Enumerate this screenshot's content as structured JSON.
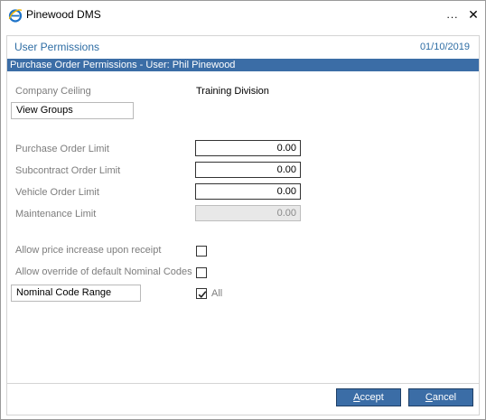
{
  "window": {
    "title": "Pinewood DMS",
    "more_glyph": "...",
    "close_glyph": "✕",
    "icon": "ie-browser-icon"
  },
  "dialog": {
    "section_title": "User Permissions",
    "date": "01/10/2019",
    "subheader": "Purchase Order Permissions - User: Phil Pinewood"
  },
  "company": {
    "label": "Company Ceiling",
    "value": "Training Division",
    "view_groups_label": "View Groups"
  },
  "limits": [
    {
      "label": "Purchase Order Limit",
      "value": "0.00",
      "enabled": true
    },
    {
      "label": "Subcontract Order Limit",
      "value": "0.00",
      "enabled": true
    },
    {
      "label": "Vehicle Order Limit",
      "value": "0.00",
      "enabled": true
    },
    {
      "label": "Maintenance Limit",
      "value": "0.00",
      "enabled": false
    }
  ],
  "options": {
    "price_increase_label": "Allow price increase upon receipt",
    "price_increase_checked": false,
    "override_nominal_label": "Allow override of default Nominal Codes",
    "override_nominal_checked": false,
    "nominal_range_label": "Nominal Code Range",
    "all_label": "All",
    "all_checked": true
  },
  "actions": {
    "accept_accel": "A",
    "accept_rest": "ccept",
    "cancel_accel": "C",
    "cancel_rest": "ancel"
  },
  "colors": {
    "accent": "#3b6da6",
    "title_text": "#2e6da4",
    "label_text": "#7d7d7d"
  }
}
